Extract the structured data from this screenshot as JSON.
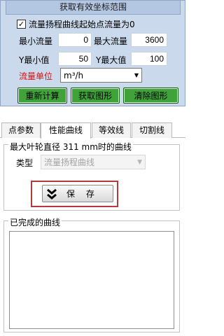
{
  "range_panel": {
    "header": "获取有效坐标范围",
    "start_zero_checkbox": {
      "label": "流量扬程曲线起始点流量为0",
      "checked": true
    },
    "min_flow": {
      "label": "最小流量",
      "value": "0"
    },
    "max_flow": {
      "label": "最大流量",
      "value": "3600"
    },
    "y_min": {
      "label": "Y最小值",
      "value": "50"
    },
    "y_max": {
      "label": "Y最大值",
      "value": "100"
    },
    "flow_unit": {
      "label": "流量单位",
      "value": "m³/h"
    },
    "buttons": {
      "recalc": "重新计算",
      "get_graph": "获取图形",
      "clear_graph": "清除图形"
    }
  },
  "tabs": [
    {
      "label": "点参数",
      "active": false
    },
    {
      "label": "性能曲线",
      "active": true
    },
    {
      "label": "等效线",
      "active": false
    },
    {
      "label": "切割线",
      "active": false
    }
  ],
  "performance_tab": {
    "curve_group_title": "最大叶轮直径 311 mm时的曲线",
    "type_label": "类型",
    "type_value": "流量扬程曲线",
    "save_label": "保 存",
    "completed_group_title": "已完成的曲线"
  },
  "colors": {
    "panel_bg": "#cbd9ec",
    "button_green": "#3fa33a",
    "unit_label_red": "#d21313",
    "highlight_frame": "#b53a3e"
  }
}
